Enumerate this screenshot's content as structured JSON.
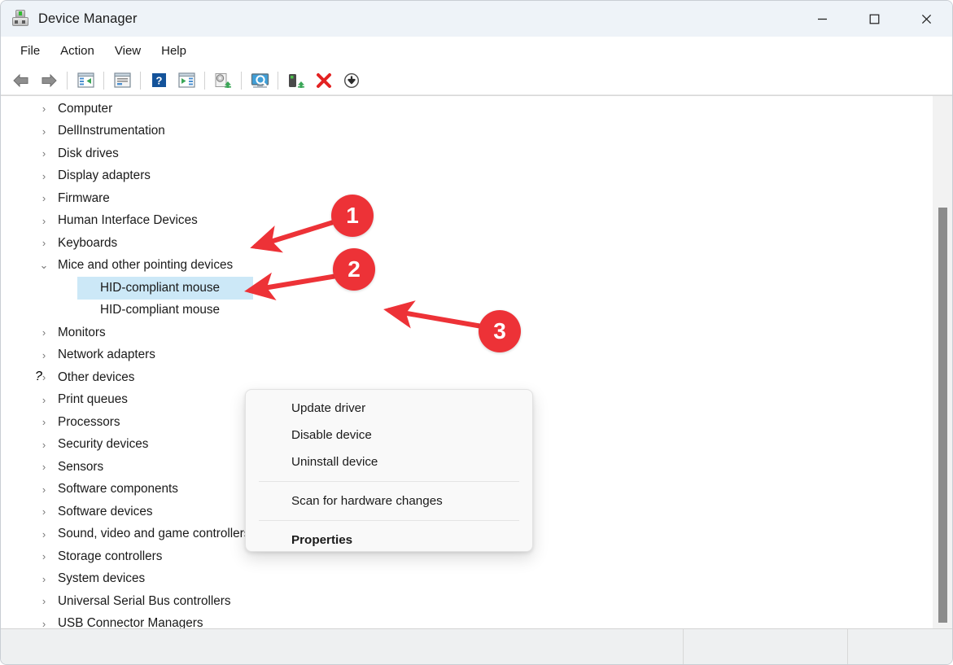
{
  "window": {
    "title": "Device Manager",
    "icon": "device-manager-icon",
    "controls": {
      "minimize": "—",
      "maximize": "☐",
      "close": "✕"
    }
  },
  "menubar": {
    "items": [
      {
        "label": "File"
      },
      {
        "label": "Action"
      },
      {
        "label": "View"
      },
      {
        "label": "Help"
      }
    ]
  },
  "toolbar": {
    "buttons": [
      {
        "name": "back-icon"
      },
      {
        "name": "forward-icon"
      },
      {
        "name": "show-hide-console-tree-icon"
      },
      {
        "name": "properties-icon"
      },
      {
        "name": "help-icon"
      },
      {
        "name": "show-hide-action-pane-icon"
      },
      {
        "name": "update-driver-icon"
      },
      {
        "name": "scan-for-hardware-changes-icon"
      },
      {
        "name": "uninstall-device-icon"
      },
      {
        "name": "disable-device-icon"
      },
      {
        "name": "enable-device-icon"
      }
    ]
  },
  "tree": {
    "nodes": [
      {
        "label": "Computer",
        "icon": "monitor-icon",
        "state": "collapsed",
        "level": 0
      },
      {
        "label": "DellInstrumentation",
        "icon": "network-computers-icon",
        "state": "collapsed",
        "level": 0
      },
      {
        "label": "Disk drives",
        "icon": "disk-drive-icon",
        "state": "collapsed",
        "level": 0
      },
      {
        "label": "Display adapters",
        "icon": "display-adapter-icon",
        "state": "collapsed",
        "level": 0
      },
      {
        "label": "Firmware",
        "icon": "firmware-chip-icon",
        "state": "collapsed",
        "level": 0
      },
      {
        "label": "Human Interface Devices",
        "icon": "gamepad-icon",
        "state": "collapsed",
        "level": 0
      },
      {
        "label": "Keyboards",
        "icon": "keyboard-icon",
        "state": "collapsed",
        "level": 0
      },
      {
        "label": "Mice and other pointing devices",
        "icon": "mouse-icon",
        "state": "expanded",
        "level": 0
      },
      {
        "label": "HID-compliant mouse",
        "icon": "mouse-icon",
        "state": "leaf",
        "level": 1,
        "selected": true
      },
      {
        "label": "HID-compliant mouse",
        "icon": "mouse-icon",
        "state": "leaf",
        "level": 1,
        "selected": false
      },
      {
        "label": "Monitors",
        "icon": "monitor-icon",
        "state": "collapsed",
        "level": 0
      },
      {
        "label": "Network adapters",
        "icon": "network-computers-icon",
        "state": "collapsed",
        "level": 0
      },
      {
        "label": "Other devices",
        "icon": "unknown-device-icon",
        "state": "collapsed",
        "level": 0
      },
      {
        "label": "Print queues",
        "icon": "printer-icon",
        "state": "collapsed",
        "level": 0
      },
      {
        "label": "Processors",
        "icon": "processor-icon",
        "state": "collapsed",
        "level": 0
      },
      {
        "label": "Security devices",
        "icon": "security-key-icon",
        "state": "collapsed",
        "level": 0
      },
      {
        "label": "Sensors",
        "icon": "sensors-icon",
        "state": "collapsed",
        "level": 0
      },
      {
        "label": "Software components",
        "icon": "software-component-icon",
        "state": "collapsed",
        "level": 0
      },
      {
        "label": "Software devices",
        "icon": "software-device-icon",
        "state": "collapsed",
        "level": 0
      },
      {
        "label": "Sound, video and game controllers",
        "icon": "speaker-icon",
        "state": "collapsed",
        "level": 0
      },
      {
        "label": "Storage controllers",
        "icon": "storage-controller-icon",
        "state": "collapsed",
        "level": 0
      },
      {
        "label": "System devices",
        "icon": "system-device-icon",
        "state": "collapsed",
        "level": 0
      },
      {
        "label": "Universal Serial Bus controllers",
        "icon": "usb-icon",
        "state": "collapsed",
        "level": 0
      },
      {
        "label": "USB Connector Managers",
        "icon": "usb-icon",
        "state": "collapsed",
        "level": 0
      }
    ],
    "chevron_collapsed": "›",
    "chevron_expanded": "⌄",
    "selection_color": "#cce8f7"
  },
  "context_menu": {
    "items": [
      {
        "label": "Update driver",
        "bold": false
      },
      {
        "label": "Disable device",
        "bold": false
      },
      {
        "label": "Uninstall device",
        "bold": false
      },
      {
        "separator": true
      },
      {
        "label": "Scan for hardware changes",
        "bold": false
      },
      {
        "separator": true
      },
      {
        "label": "Properties",
        "bold": true
      }
    ]
  },
  "annotations": {
    "color": "#ed3237",
    "badges": [
      {
        "id": "1",
        "label": "1",
        "points_to": "Keyboards"
      },
      {
        "id": "2",
        "label": "2",
        "points_to": "HID-compliant mouse"
      },
      {
        "id": "3",
        "label": "3",
        "points_to": "Update driver"
      }
    ]
  },
  "statusbar": {
    "panes": [
      "",
      "",
      ""
    ]
  },
  "scrollbar": {
    "orientation": "vertical",
    "thumb_top_pct": 21,
    "thumb_height_pct": 78
  }
}
